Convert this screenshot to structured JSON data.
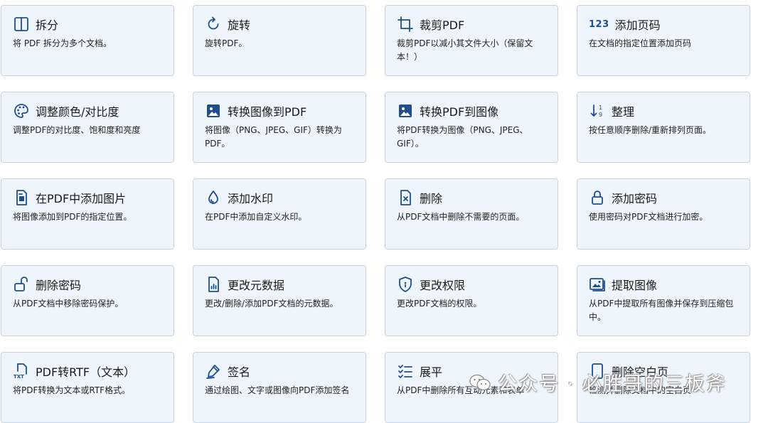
{
  "cards": [
    {
      "icon": "split-icon",
      "title": "拆分",
      "desc": "将 PDF 拆分为多个文档。"
    },
    {
      "icon": "rotate-icon",
      "title": "旋转",
      "desc": "旋转PDF。"
    },
    {
      "icon": "crop-icon",
      "title": "裁剪PDF",
      "desc": "裁剪PDF以减小其文件大小（保留文本！）"
    },
    {
      "icon": "page-number-icon",
      "icon_text": "123",
      "title": "添加页码",
      "desc": "在文档的指定位置添加页码"
    },
    {
      "icon": "palette-icon",
      "title": "调整颜色/对比度",
      "desc": "调整PDF的对比度、饱和度和亮度"
    },
    {
      "icon": "image-icon",
      "title": "转换图像到PDF",
      "desc": "将图像（PNG、JPEG、GIF）转换为PDF。"
    },
    {
      "icon": "image-icon",
      "title": "转换PDF到图像",
      "desc": "将PDF转换为图像（PNG、JPEG、GIF）。"
    },
    {
      "icon": "sort-icon",
      "title": "整理",
      "desc": "按任意顺序删除/重新排列页面。"
    },
    {
      "icon": "add-image-icon",
      "title": "在PDF中添加图片",
      "desc": "将图像添加到PDF的指定位置。"
    },
    {
      "icon": "water-drop-icon",
      "title": "添加水印",
      "desc": "在PDF中添加自定义水印。"
    },
    {
      "icon": "delete-file-icon",
      "title": "删除",
      "desc": "从PDF文档中删除不需要的页面。"
    },
    {
      "icon": "lock-icon",
      "title": "添加密码",
      "desc": "使用密码对PDF文档进行加密。"
    },
    {
      "icon": "unlock-icon",
      "title": "删除密码",
      "desc": "从PDF文档中移除密码保护。"
    },
    {
      "icon": "metadata-icon",
      "title": "更改元数据",
      "desc": "更改/删除/添加PDF文档的元数据。"
    },
    {
      "icon": "shield-icon",
      "title": "更改权限",
      "desc": "更改PDF文档的权限。"
    },
    {
      "icon": "images-icon",
      "title": "提取图像",
      "desc": "从PDF中提取所有图像并保存到压缩包中。"
    },
    {
      "icon": "txt-file-icon",
      "title": "PDF转RTF（文本）",
      "desc": "将PDF转换为文本或RTF格式。"
    },
    {
      "icon": "signature-icon",
      "title": "签名",
      "desc": "通过绘图、文字或图像向PDF添加签名"
    },
    {
      "icon": "flatten-icon",
      "title": "展平",
      "desc": "从PDF中删除所有互动元素和表单"
    },
    {
      "icon": "blank-page-icon",
      "title": "删除空白页",
      "desc": "检测并删除文档中的空白页"
    }
  ],
  "watermark": {
    "text": "公众号 · 必胜哥的三板斧"
  },
  "colors": {
    "card_bg": "#eef5fc",
    "card_border": "#c9d3df",
    "icon": "#1f4e8c"
  }
}
